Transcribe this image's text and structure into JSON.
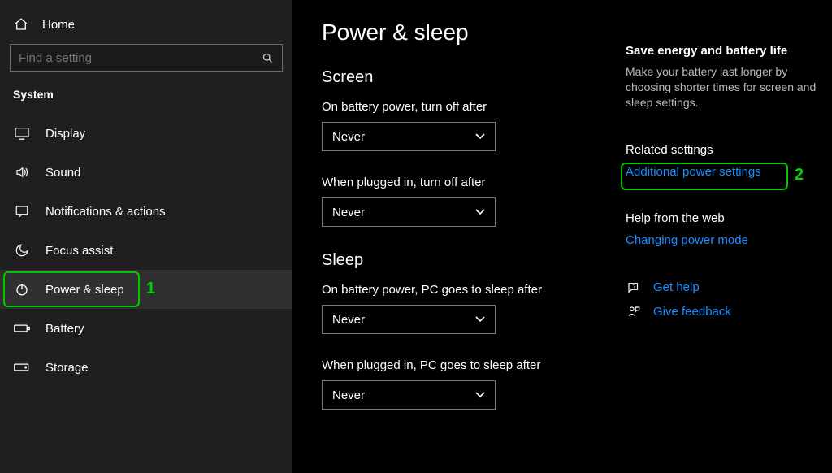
{
  "sidebar": {
    "home_label": "Home",
    "search_placeholder": "Find a setting",
    "section_title": "System",
    "items": [
      {
        "label": "Display"
      },
      {
        "label": "Sound"
      },
      {
        "label": "Notifications & actions"
      },
      {
        "label": "Focus assist"
      },
      {
        "label": "Power & sleep"
      },
      {
        "label": "Battery"
      },
      {
        "label": "Storage"
      }
    ]
  },
  "main": {
    "page_title": "Power & sleep",
    "screen": {
      "group_title": "Screen",
      "battery_label": "On battery power, turn off after",
      "battery_value": "Never",
      "plugged_label": "When plugged in, turn off after",
      "plugged_value": "Never"
    },
    "sleep": {
      "group_title": "Sleep",
      "battery_label": "On battery power, PC goes to sleep after",
      "battery_value": "Never",
      "plugged_label": "When plugged in, PC goes to sleep after",
      "plugged_value": "Never"
    }
  },
  "info": {
    "energy_title": "Save energy and battery life",
    "energy_desc": "Make your battery last longer by choosing shorter times for screen and sleep settings.",
    "related_title": "Related settings",
    "related_link": "Additional power settings",
    "help_title": "Help from the web",
    "help_link": "Changing power mode",
    "get_help": "Get help",
    "give_feedback": "Give feedback"
  },
  "annotations": {
    "num1": "1",
    "num2": "2"
  }
}
